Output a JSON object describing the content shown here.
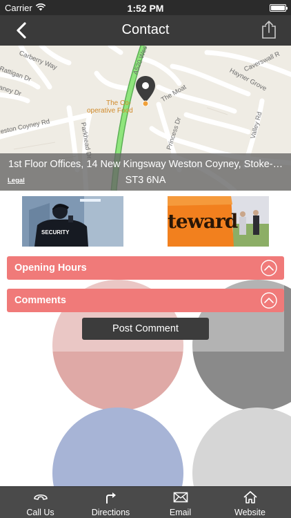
{
  "status_bar": {
    "carrier": "Carrier",
    "time": "1:52 PM"
  },
  "nav": {
    "title": "Contact",
    "back_icon": "chevron-left-icon",
    "share_icon": "share-icon"
  },
  "map": {
    "street_labels": {
      "carberry": "Carberry Way",
      "rattigan": "Rattigan Dr",
      "aney": "aney Dr",
      "a520": "A520 Wes",
      "moat": "The Moat",
      "hayner": "Hayner Grove",
      "caverswall": "Caverswall R",
      "valley": "Valley Rd",
      "princess": "Princess Dr",
      "weston": "eston Coyney Rd",
      "parkhead": "Parkhead Dr"
    },
    "poi": {
      "line1": "The Co-",
      "line2": "operative Food"
    },
    "legal": "Legal"
  },
  "address": {
    "line1": "1st Floor Offices, 14 New Kingsway Weston Coyney, Stoke-o...",
    "line2": "ST3 6NA"
  },
  "photos": {
    "security_badge": "SECURITY",
    "steward_sign": "teward"
  },
  "sections": {
    "opening_hours": "Opening Hours",
    "comments": "Comments"
  },
  "post_comment": "Post Comment",
  "tabs": [
    {
      "label": "Call Us",
      "icon": "phone-icon"
    },
    {
      "label": "Directions",
      "icon": "directions-arrow-icon"
    },
    {
      "label": "Email",
      "icon": "envelope-icon"
    },
    {
      "label": "Website",
      "icon": "home-icon"
    }
  ],
  "colors": {
    "accordion": "#f07a79",
    "nav_bar": "#3a3a3a",
    "tab_bar": "#4a4a4a",
    "map_road_highlight": "#7bd36b"
  }
}
